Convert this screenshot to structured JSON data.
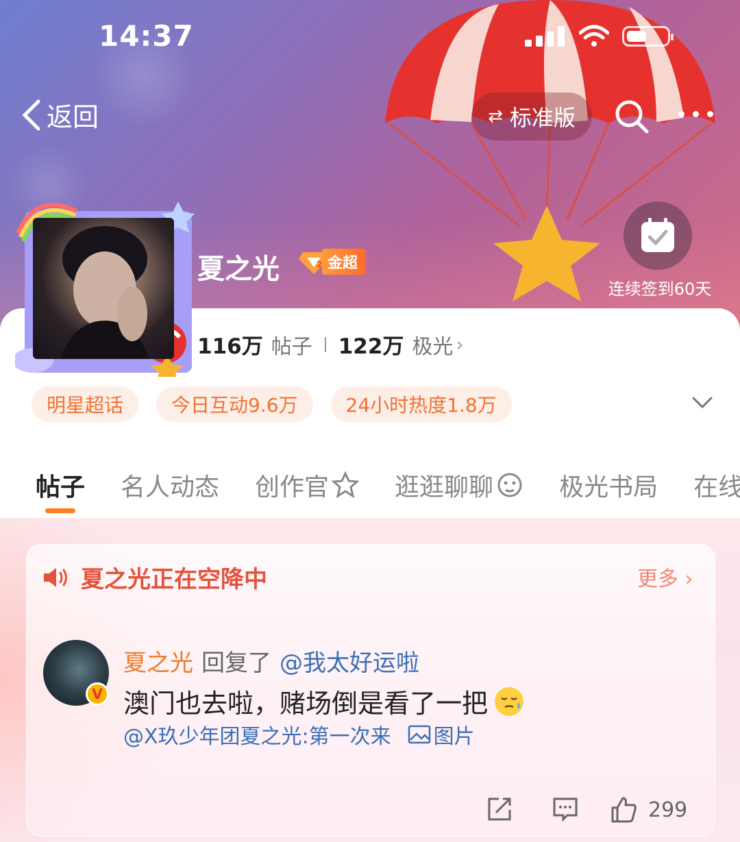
{
  "status_bar": {
    "time": "14:37"
  },
  "nav": {
    "back_label": "返回",
    "version_label": "标准版"
  },
  "checkin": {
    "label": "连续签到60天"
  },
  "topic": {
    "title": "夏之光",
    "badge": "金超"
  },
  "stats": {
    "posts_value": "116万",
    "posts_label": "帖子",
    "aurora_value": "122万",
    "aurora_label": "极光"
  },
  "tags": [
    "明星超话",
    "今日互动9.6万",
    "24小时热度1.8万"
  ],
  "tabs": [
    "帖子",
    "名人动态",
    "创作官",
    "逛逛聊聊",
    "极光书局",
    "在线"
  ],
  "airdrop": {
    "title": "夏之光正在空降中",
    "more": "更多",
    "post": {
      "user": "夏之光",
      "reply_text": "回复了",
      "mention": "@我太好运啦",
      "content": "澳门也去啦，赌场倒是看了一把",
      "source": "@X玖少年团夏之光:第一次来",
      "image_label": "图片",
      "like_count": "299"
    }
  },
  "colors": {
    "accent": "#ff7d1f",
    "tag_text": "#f0722f",
    "tag_bg": "#fdeee8",
    "link": "#3b6fb5",
    "alert": "#e5523c"
  }
}
